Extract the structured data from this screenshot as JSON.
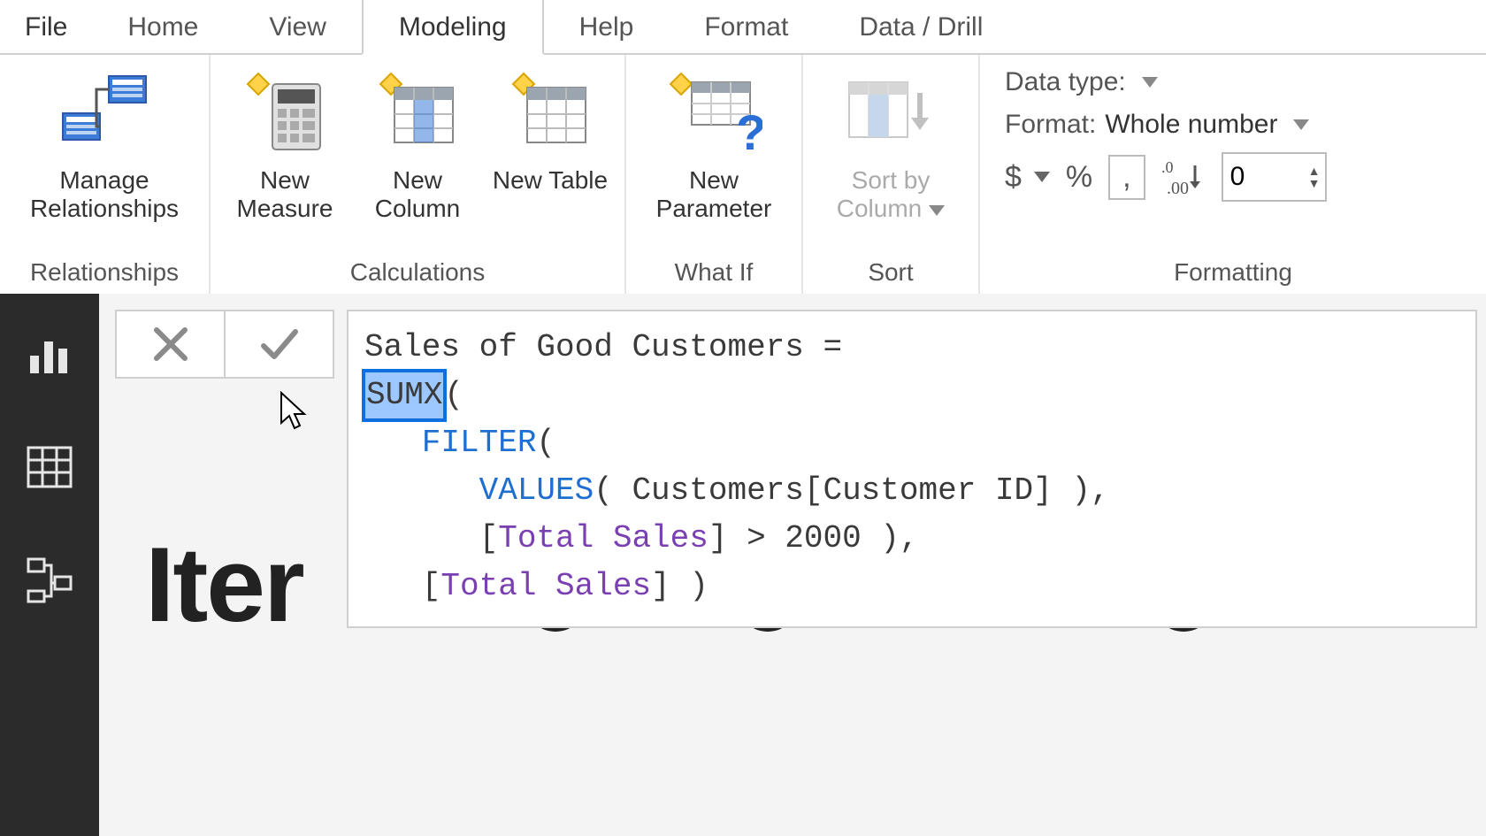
{
  "tabs": {
    "file": "File",
    "home": "Home",
    "view": "View",
    "modeling": "Modeling",
    "help": "Help",
    "format": "Format",
    "data_drill": "Data / Drill"
  },
  "ribbon": {
    "groups": {
      "relationships": {
        "label": "Relationships",
        "manage": "Manage Relationships"
      },
      "calculations": {
        "label": "Calculations",
        "new_measure": "New Measure",
        "new_column": "New Column",
        "new_table": "New Table"
      },
      "whatif": {
        "label": "What If",
        "new_parameter": "New Parameter"
      },
      "sort": {
        "label": "Sort",
        "sort_by_column": "Sort by Column"
      },
      "formatting": {
        "label": "Formatting",
        "data_type_label": "Data type:",
        "format_label": "Format:",
        "format_value": "Whole number",
        "currency": "$",
        "percent": "%",
        "thousands": ",",
        "decimal_icon": ".0 .00",
        "decimals_value": "0"
      }
    }
  },
  "sidenav": {
    "report": "report-view",
    "data": "data-view",
    "model": "model-view"
  },
  "formula": {
    "name_line": "Sales of Good Customers =",
    "selected_token": "SUMX",
    "paren_after_sel": "(",
    "filter_kw": "FILTER",
    "filter_open": "(",
    "values_kw": "VALUES",
    "values_args": "( Customers[Customer ID] ),",
    "cond_open": "[",
    "cond_measure": "Total Sales",
    "cond_rest": "] > 2000 ),",
    "ret_open": "[",
    "ret_measure": "Total Sales",
    "ret_rest": "] )"
  },
  "background_text": "Iter"
}
